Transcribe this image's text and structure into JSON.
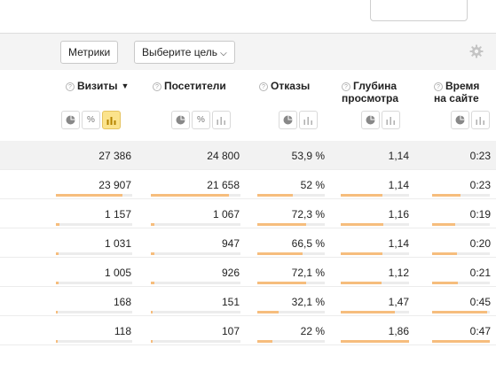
{
  "toolbar": {
    "metrics_label": "Метрики",
    "goal_label": "Выберите цель"
  },
  "columns": [
    {
      "title": "Визиты",
      "sort": "▼"
    },
    {
      "title": "Посетители"
    },
    {
      "title": "Отказы"
    },
    {
      "title": "Глубина просмотра"
    },
    {
      "title": "Время на сайте"
    }
  ],
  "view_buttons": {
    "pie": "pie-chart-icon",
    "percent": "%",
    "bars": "bar-chart-icon"
  },
  "totals": [
    "27 386",
    "24 800",
    "53,9 %",
    "1,14",
    "0:23"
  ],
  "rows": [
    {
      "values": [
        "23 907",
        "21 658",
        "52 %",
        "1,14",
        "0:23"
      ],
      "shares": [
        0.873,
        0.873,
        0.52,
        0.61,
        0.49
      ]
    },
    {
      "values": [
        "1 157",
        "1 067",
        "72,3 %",
        "1,16",
        "0:19"
      ],
      "shares": [
        0.042,
        0.043,
        0.723,
        0.62,
        0.4
      ]
    },
    {
      "values": [
        "1 031",
        "947",
        "66,5 %",
        "1,14",
        "0:20"
      ],
      "shares": [
        0.038,
        0.038,
        0.665,
        0.61,
        0.43
      ]
    },
    {
      "values": [
        "1 005",
        "926",
        "72,1 %",
        "1,12",
        "0:21"
      ],
      "shares": [
        0.037,
        0.037,
        0.721,
        0.6,
        0.45
      ]
    },
    {
      "values": [
        "168",
        "151",
        "32,1 %",
        "1,47",
        "0:45"
      ],
      "shares": [
        0.006,
        0.006,
        0.321,
        0.79,
        0.96
      ]
    },
    {
      "values": [
        "118",
        "107",
        "22 %",
        "1,86",
        "0:47"
      ],
      "shares": [
        0.004,
        0.004,
        0.22,
        1.0,
        1.0
      ]
    }
  ],
  "colors": {
    "bar_fill": "#f6bd7d",
    "bar_track": "#ececec",
    "active_button": "#fbe38c",
    "total_row": "#f2f2f2"
  }
}
